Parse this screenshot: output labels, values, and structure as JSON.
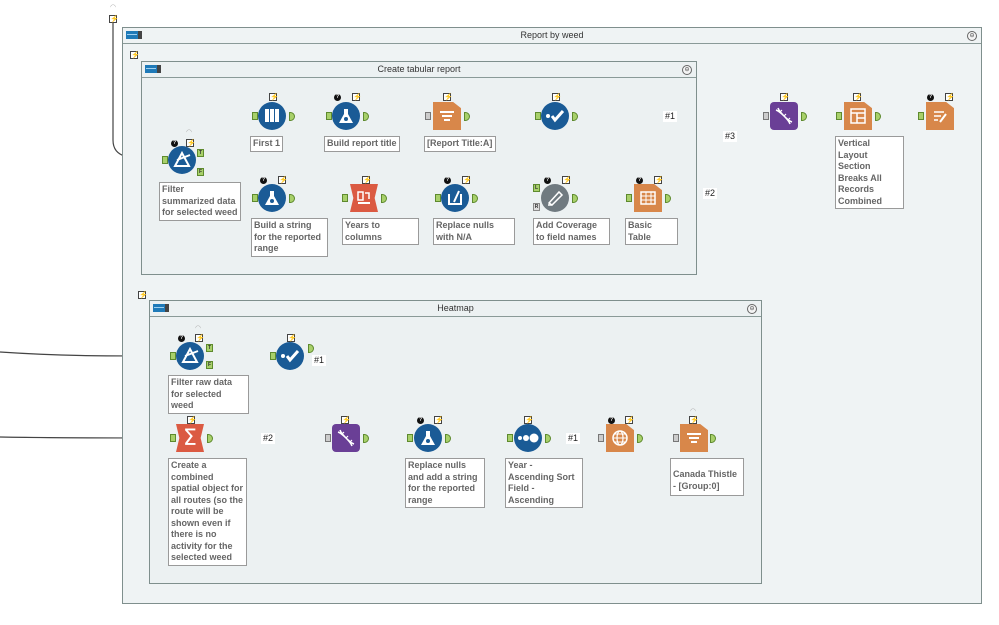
{
  "containers": {
    "outer": {
      "title": "Report by weed",
      "collapse_icon": "⊖"
    },
    "tabular": {
      "title": "Create tabular report",
      "collapse_icon": "⊖"
    },
    "heatmap": {
      "title": "Heatmap",
      "collapse_icon": "⊖"
    }
  },
  "badges": {
    "bolt": "⚡",
    "question": "?"
  },
  "tools": {
    "filter_summarized": {
      "annotation": "Filter summarized data for selected weed",
      "true_anchor": "T",
      "false_anchor": "F"
    },
    "first_1": {
      "annotation": "First 1"
    },
    "build_title": {
      "annotation": "Build report title"
    },
    "report_text": {
      "annotation": "[Report Title:A]"
    },
    "select_top": {
      "annotation": ""
    },
    "build_string": {
      "annotation": "Build a string for the reported range"
    },
    "years_to_columns": {
      "annotation": "Years to columns"
    },
    "replace_nulls_na": {
      "annotation": "Replace nulls with N/A"
    },
    "add_coverage": {
      "annotation": "Add Coverage to field names",
      "left_anchor": "L",
      "right_anchor": "R"
    },
    "basic_table": {
      "annotation": "Basic Table"
    },
    "union_main": {
      "annotation": ""
    },
    "layout": {
      "annotation": "Vertical Layout Section Breaks All Records Combined"
    },
    "render": {
      "annotation": ""
    },
    "filter_raw": {
      "annotation": "Filter raw data for selected weed",
      "true_anchor": "T",
      "false_anchor": "F"
    },
    "select_heat": {
      "annotation": ""
    },
    "summarize_spatial": {
      "annotation": "Create a combined spatial object for all routes (so the route will be shown even if there is no activity for the selected weed"
    },
    "union_heat": {
      "annotation": ""
    },
    "replace_nulls_string": {
      "annotation": "Replace nulls and add a string for the reported range"
    },
    "sort": {
      "annotation": "Year - Ascending Sort Field - Ascending"
    },
    "map": {
      "annotation": ""
    },
    "report_text_heat": {
      "annotation": "Canada Thistle - [Group:0]"
    }
  },
  "connection_labels": {
    "top_1": "#1",
    "top_2": "#2",
    "top_3": "#3",
    "heat_1": "#1",
    "heat_2": "#2",
    "heat_sort_1": "#1"
  }
}
